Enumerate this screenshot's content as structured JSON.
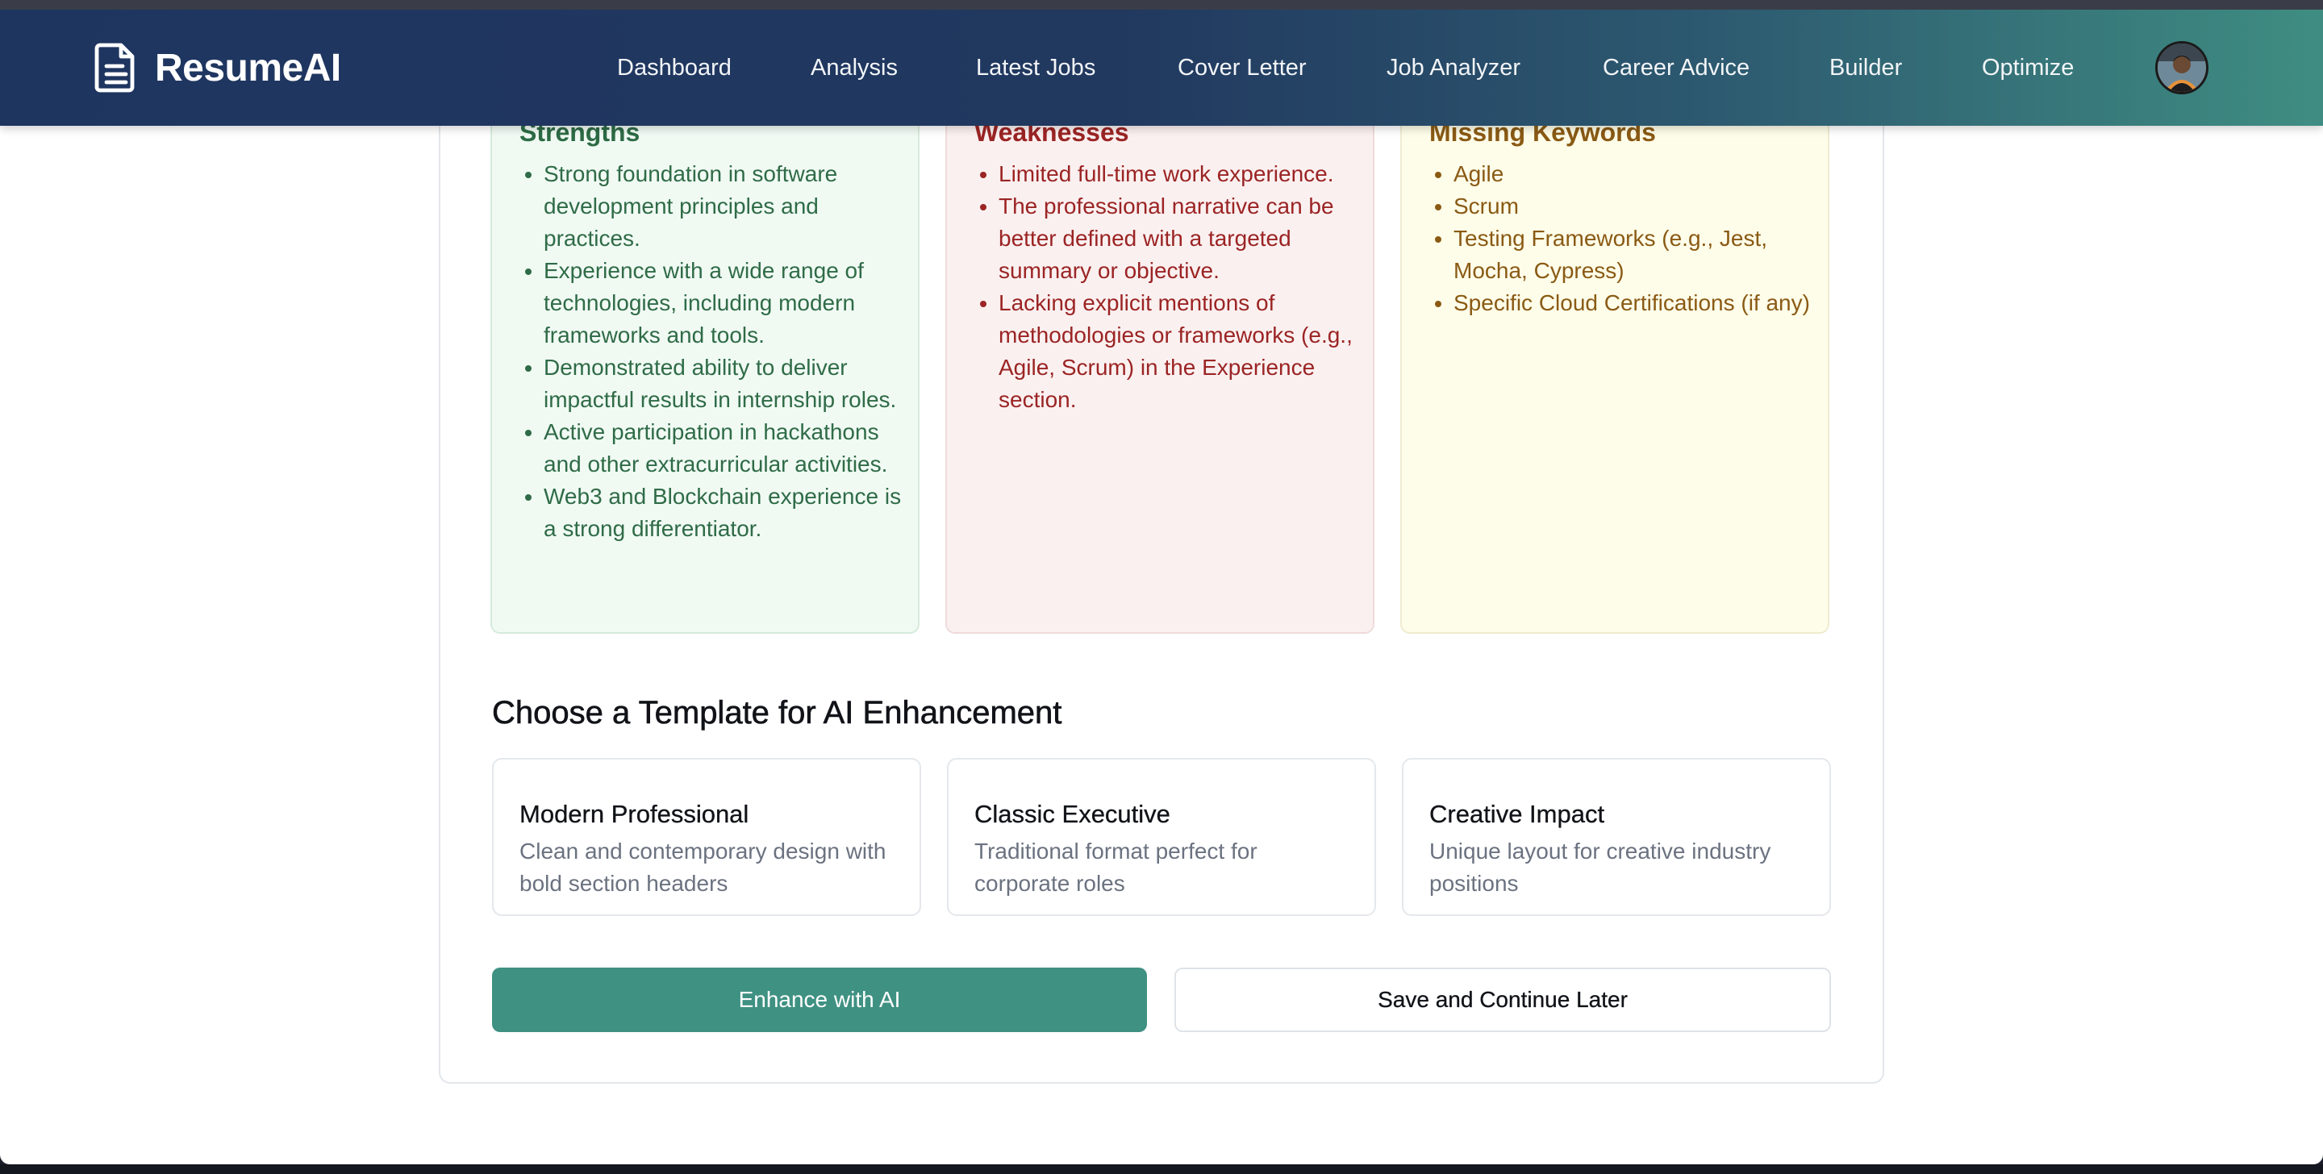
{
  "app": {
    "name": "ResumeAI"
  },
  "nav": {
    "items": [
      "Dashboard",
      "Analysis",
      "Latest Jobs",
      "Cover Letter",
      "Job Analyzer",
      "Career Advice",
      "Builder",
      "Optimize"
    ]
  },
  "analysis": {
    "strengths": {
      "title": "Strengths",
      "items": [
        "Strong foundation in software development principles and practices.",
        "Experience with a wide range of technologies, including modern frameworks and tools.",
        "Demonstrated ability to deliver impactful results in internship roles.",
        "Active participation in hackathons and other extracurricular activities.",
        "Web3 and Blockchain experience is a strong differentiator."
      ]
    },
    "weaknesses": {
      "title": "Weaknesses",
      "items": [
        "Limited full-time work experience.",
        "The professional narrative can be better defined with a targeted summary or objective.",
        "Lacking explicit mentions of methodologies or frameworks (e.g., Agile, Scrum) in the Experience section."
      ]
    },
    "missing_keywords": {
      "title": "Missing Keywords",
      "items": [
        "Agile",
        "Scrum",
        "Testing Frameworks (e.g., Jest, Mocha, Cypress)",
        "Specific Cloud Certifications (if any)"
      ]
    }
  },
  "templates": {
    "heading": "Choose a Template for AI Enhancement",
    "items": [
      {
        "name": "Modern Professional",
        "description": "Clean and contemporary design with bold section headers"
      },
      {
        "name": "Classic Executive",
        "description": "Traditional format perfect for corporate roles"
      },
      {
        "name": "Creative Impact",
        "description": "Unique layout for creative industry positions"
      }
    ]
  },
  "actions": {
    "enhance_label": "Enhance with AI",
    "save_label": "Save and Continue Later"
  },
  "colors": {
    "header_start": "#1e3560",
    "header_end": "#3f8d82",
    "accent": "#3f9182",
    "strengths_text": "#2f6b47",
    "weaknesses_text": "#9b2424",
    "keywords_text": "#8a5a14"
  }
}
